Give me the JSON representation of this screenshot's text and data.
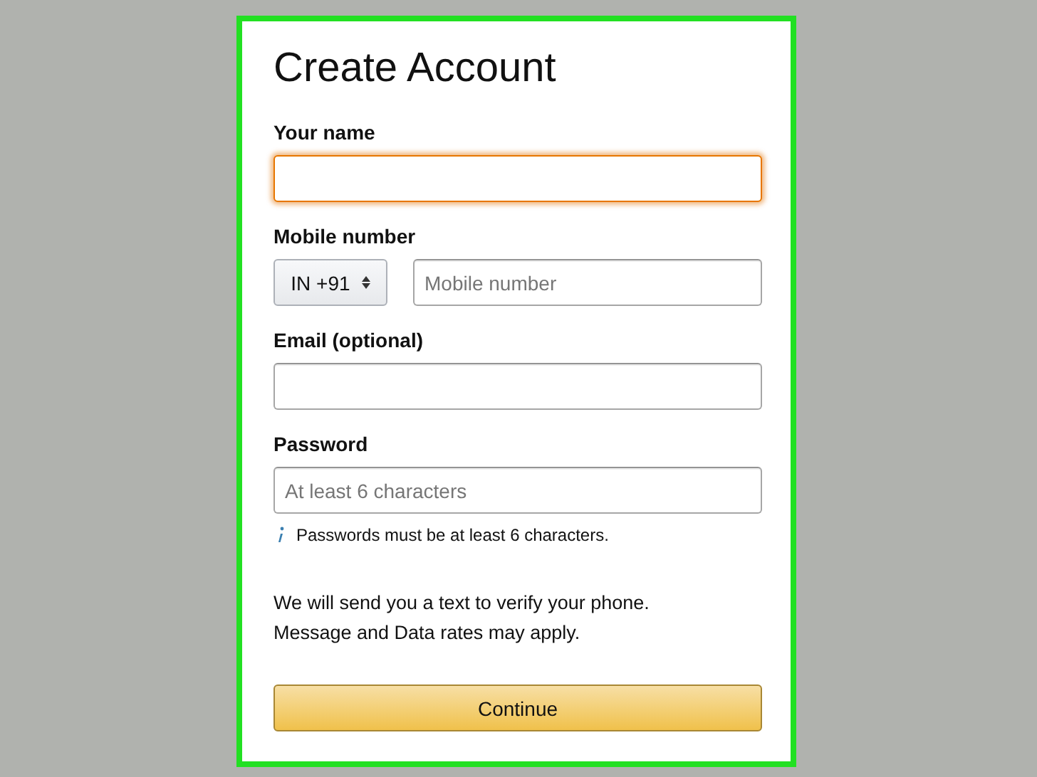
{
  "title": "Create Account",
  "fields": [
    {
      "kind": "text",
      "label": "Your name",
      "focused": true
    },
    {
      "kind": "phone",
      "label": "Mobile number",
      "country": "IN +91",
      "placeholder": "Mobile number",
      "focused": false
    },
    {
      "kind": "text",
      "label": "Email (optional)",
      "focused": false
    },
    {
      "kind": "text",
      "label": "Password",
      "placeholder": "At least 6 characters",
      "hint": "Passwords must be at least 6 characters.",
      "focused": false
    }
  ],
  "notice": [
    "We will send you a text to verify your phone.",
    "Message and Data rates may apply."
  ],
  "button": "Continue"
}
